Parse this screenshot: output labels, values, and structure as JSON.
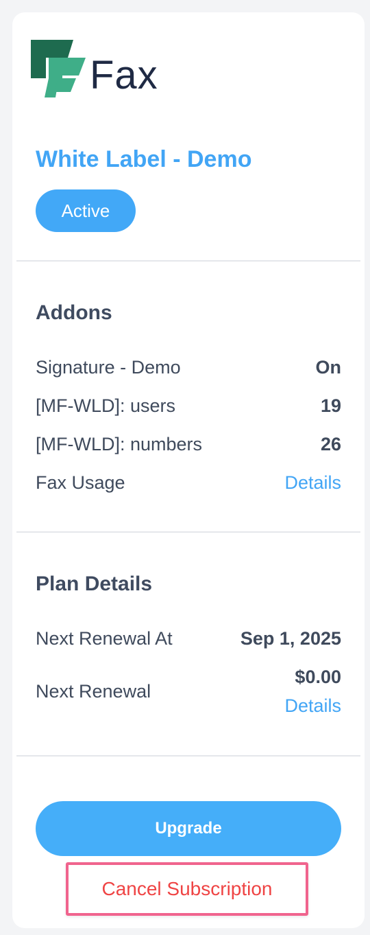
{
  "brand": {
    "logo_text": "Fax",
    "logo_colors": {
      "dark": "#1e6b4f",
      "light": "#3fae88"
    }
  },
  "plan": {
    "title": "White Label - Demo",
    "status": "Active"
  },
  "addons": {
    "title": "Addons",
    "rows": [
      {
        "label": "Signature - Demo",
        "value": "On"
      },
      {
        "label": "[MF-WLD]: users",
        "value": "19"
      },
      {
        "label": "[MF-WLD]: numbers",
        "value": "26"
      },
      {
        "label": "Fax Usage",
        "link": "Details"
      }
    ]
  },
  "plan_details": {
    "title": "Plan Details",
    "next_renewal_at_label": "Next Renewal At",
    "next_renewal_at_value": "Sep 1, 2025",
    "next_renewal_label": "Next Renewal",
    "next_renewal_amount": "$0.00",
    "next_renewal_link": "Details"
  },
  "actions": {
    "upgrade_label": "Upgrade",
    "cancel_label": "Cancel Subscription"
  },
  "colors": {
    "accent": "#42a5f5",
    "button": "#45aef9",
    "danger": "#ef4444",
    "highlight_border": "#f0648e"
  }
}
